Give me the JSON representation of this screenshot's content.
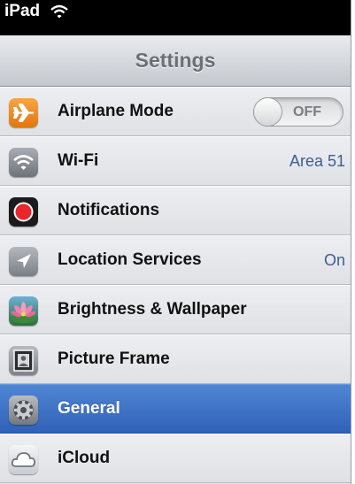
{
  "status_bar": {
    "device_label": "iPad",
    "wifi_icon": "wifi-icon"
  },
  "nav": {
    "title": "Settings"
  },
  "rows": [
    {
      "label": "Airplane Mode",
      "icon": "airplane-icon",
      "toggle_state": "OFF",
      "value": ""
    },
    {
      "label": "Wi-Fi",
      "icon": "wifi-icon",
      "value": "Area 51"
    },
    {
      "label": "Notifications",
      "icon": "notifications-icon",
      "value": ""
    },
    {
      "label": "Location Services",
      "icon": "location-arrow-icon",
      "value": "On"
    },
    {
      "label": "Brightness & Wallpaper",
      "icon": "flower-icon",
      "value": ""
    },
    {
      "label": "Picture Frame",
      "icon": "picture-frame-icon",
      "value": ""
    },
    {
      "label": "General",
      "icon": "gear-icon",
      "value": "",
      "selected": true
    },
    {
      "label": "iCloud",
      "icon": "cloud-icon",
      "value": ""
    }
  ],
  "colors": {
    "selected_row": "#3a6fc4",
    "value_text": "#3d5f8f",
    "airplane_icon_bg": "#f08a1c",
    "notifications_icon_bg": "#e8262b"
  }
}
